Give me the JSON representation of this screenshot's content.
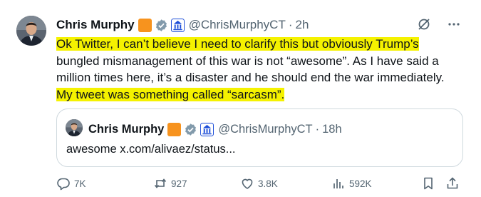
{
  "tweet": {
    "author": {
      "name": "Chris Murphy",
      "handle": "@ChrisMurphyCT",
      "time": "2h"
    },
    "separator": "·",
    "text": {
      "line1": "Ok Twitter, I can’t believe I need to clarify this but obviously Trump’s",
      "line2": "bungled mismanagement of this war is not “awesome”. As I have said a",
      "line3": "million times here, it’s a disaster and he should end the war immediately.",
      "line4": "My tweet was something called “sarcasm”."
    },
    "highlight_color": "#f5f200",
    "quoted": {
      "name": "Chris Murphy",
      "handle": "@ChrisMurphyCT",
      "time": "18h",
      "text": "awesome x.com/alivaez/status..."
    },
    "actions": {
      "replies": "7K",
      "reposts": "927",
      "likes": "3.8K",
      "views": "592K"
    },
    "icons": {
      "org_badge_color": "#f7931e",
      "verified": "gray-checkmark-badge",
      "government": "capitol-building-badge",
      "grok": "slashed-circle-icon",
      "more": "three-dots-icon"
    }
  }
}
